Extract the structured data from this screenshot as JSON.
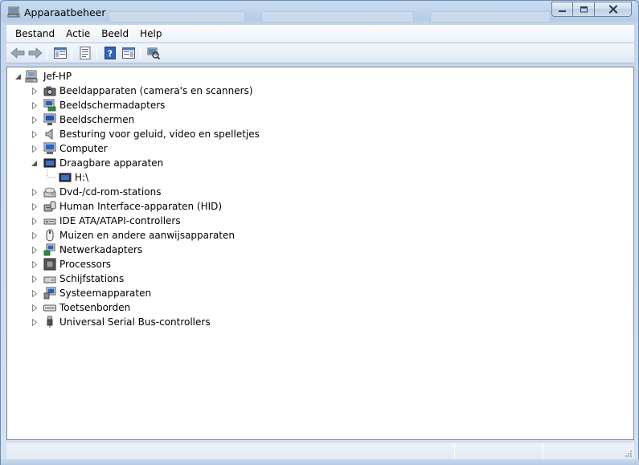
{
  "window": {
    "title": "Apparaatbeheer",
    "accent": "#c9dcf0",
    "border": "#6d8aad"
  },
  "caption_buttons": {
    "minimize_icon": "minimize-icon",
    "maximize_icon": "maximize-icon",
    "close_icon": "close-icon"
  },
  "menu": {
    "items": [
      "Bestand",
      "Actie",
      "Beeld",
      "Help"
    ]
  },
  "toolbar": {
    "buttons": [
      "back-arrow-icon",
      "forward-arrow-icon",
      "show-hide-console-tree-icon",
      "properties-icon",
      "help-icon",
      "action-pane-icon",
      "scan-hardware-icon"
    ]
  },
  "tree": {
    "root": {
      "label": "Jef-HP",
      "icon": "computer-icon",
      "expanded": true
    },
    "categories": [
      {
        "label": "Beeldapparaten (camera's en scanners)",
        "icon": "camera-icon"
      },
      {
        "label": "Beeldschermadapters",
        "icon": "display-adapter-icon"
      },
      {
        "label": "Beeldschermen",
        "icon": "monitor-icon"
      },
      {
        "label": "Besturing voor geluid, video en spelletjes",
        "icon": "speaker-icon"
      },
      {
        "label": "Computer",
        "icon": "computer-monitor-icon"
      },
      {
        "label": "Draagbare apparaten",
        "icon": "portable-device-icon",
        "expanded": true,
        "children": [
          {
            "label": "H:\\",
            "icon": "portable-device-icon"
          }
        ]
      },
      {
        "label": "Dvd-/cd-rom-stations",
        "icon": "optical-drive-icon"
      },
      {
        "label": "Human Interface-apparaten (HID)",
        "icon": "hid-icon"
      },
      {
        "label": "IDE ATA/ATAPI-controllers",
        "icon": "ide-controller-icon"
      },
      {
        "label": "Muizen en andere aanwijsapparaten",
        "icon": "mouse-icon"
      },
      {
        "label": "Netwerkadapters",
        "icon": "network-adapter-icon"
      },
      {
        "label": "Processors",
        "icon": "processor-icon"
      },
      {
        "label": "Schijfstations",
        "icon": "disk-drive-icon"
      },
      {
        "label": "Systeemapparaten",
        "icon": "system-devices-icon"
      },
      {
        "label": "Toetsenborden",
        "icon": "keyboard-icon"
      },
      {
        "label": "Universal Serial Bus-controllers",
        "icon": "usb-icon"
      }
    ]
  },
  "statusbar": {
    "text": ""
  }
}
